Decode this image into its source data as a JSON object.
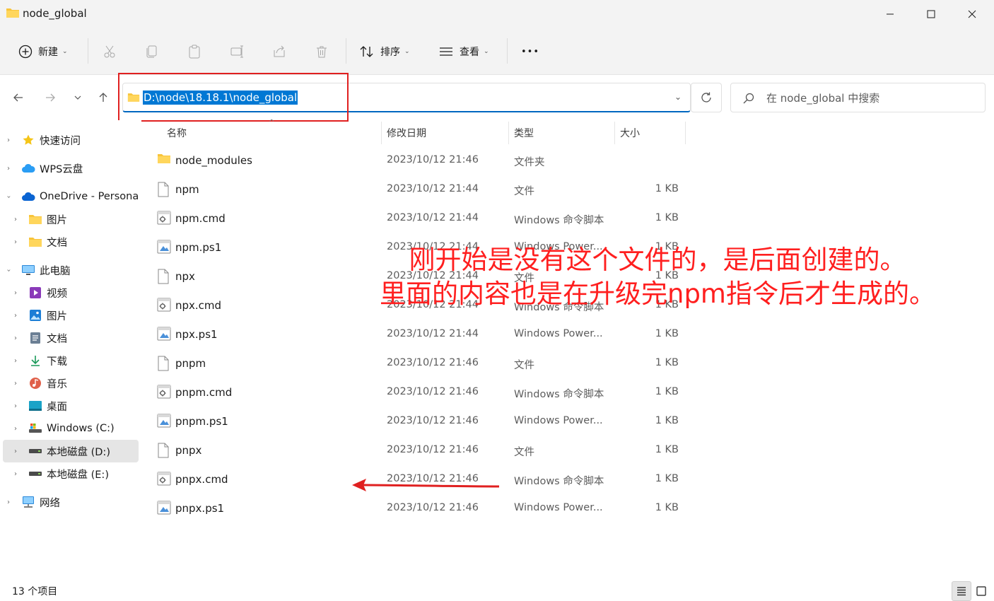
{
  "window": {
    "title": "node_global",
    "minimize_glyph": "—",
    "maximize_glyph": "☐",
    "close_glyph": "✕"
  },
  "toolbar": {
    "new_label": "新建",
    "sort_label": "排序",
    "view_label": "查看",
    "more_glyph": "•••"
  },
  "address": {
    "path": "D:\\node\\18.18.1\\node_global",
    "search_placeholder": "在 node_global 中搜索"
  },
  "sidebar": {
    "items": [
      {
        "label": "快速访问",
        "icon": "star-icon"
      },
      {
        "label": "WPS云盘",
        "icon": "cloud-icon"
      },
      {
        "label": "OneDrive - Persona",
        "icon": "onedrive-icon"
      },
      {
        "label": "图片",
        "icon": "folder-icon"
      },
      {
        "label": "文档",
        "icon": "folder-icon"
      },
      {
        "label": "此电脑",
        "icon": "computer-icon"
      },
      {
        "label": "视频",
        "icon": "video-icon"
      },
      {
        "label": "图片",
        "icon": "pictures-icon"
      },
      {
        "label": "文档",
        "icon": "documents-icon"
      },
      {
        "label": "下载",
        "icon": "download-icon"
      },
      {
        "label": "音乐",
        "icon": "music-icon"
      },
      {
        "label": "桌面",
        "icon": "desktop-icon"
      },
      {
        "label": "Windows (C:)",
        "icon": "drive-c-icon"
      },
      {
        "label": "本地磁盘 (D:)",
        "icon": "drive-icon"
      },
      {
        "label": "本地磁盘 (E:)",
        "icon": "drive-icon"
      },
      {
        "label": "网络",
        "icon": "network-icon"
      }
    ]
  },
  "columns": {
    "name": "名称",
    "date": "修改日期",
    "type": "类型",
    "size": "大小"
  },
  "files": [
    {
      "name": "node_modules",
      "date": "2023/10/12 21:46",
      "type": "文件夹",
      "size": "",
      "icon": "folder-icon"
    },
    {
      "name": "npm",
      "date": "2023/10/12 21:44",
      "type": "文件",
      "size": "1 KB",
      "icon": "file-icon"
    },
    {
      "name": "npm.cmd",
      "date": "2023/10/12 21:44",
      "type": "Windows 命令脚本",
      "size": "1 KB",
      "icon": "cmd-file-icon"
    },
    {
      "name": "npm.ps1",
      "date": "2023/10/12 21:44",
      "type": "Windows Power...",
      "size": "1 KB",
      "icon": "ps1-file-icon"
    },
    {
      "name": "npx",
      "date": "2023/10/12 21:44",
      "type": "文件",
      "size": "1 KB",
      "icon": "file-icon"
    },
    {
      "name": "npx.cmd",
      "date": "2023/10/12 21:44",
      "type": "Windows 命令脚本",
      "size": "1 KB",
      "icon": "cmd-file-icon"
    },
    {
      "name": "npx.ps1",
      "date": "2023/10/12 21:44",
      "type": "Windows Power...",
      "size": "1 KB",
      "icon": "ps1-file-icon"
    },
    {
      "name": "pnpm",
      "date": "2023/10/12 21:46",
      "type": "文件",
      "size": "1 KB",
      "icon": "file-icon"
    },
    {
      "name": "pnpm.cmd",
      "date": "2023/10/12 21:46",
      "type": "Windows 命令脚本",
      "size": "1 KB",
      "icon": "cmd-file-icon"
    },
    {
      "name": "pnpm.ps1",
      "date": "2023/10/12 21:46",
      "type": "Windows Power...",
      "size": "1 KB",
      "icon": "ps1-file-icon"
    },
    {
      "name": "pnpx",
      "date": "2023/10/12 21:46",
      "type": "文件",
      "size": "1 KB",
      "icon": "file-icon"
    },
    {
      "name": "pnpx.cmd",
      "date": "2023/10/12 21:46",
      "type": "Windows 命令脚本",
      "size": "1 KB",
      "icon": "cmd-file-icon"
    },
    {
      "name": "pnpx.ps1",
      "date": "2023/10/12 21:46",
      "type": "Windows Power...",
      "size": "1 KB",
      "icon": "ps1-file-icon"
    }
  ],
  "annotation": {
    "line1": "刚开始是没有这个文件的，是后面创建的。",
    "line2": "里面的内容也是在升级完npm指令后才生成的。",
    "color": "#ff1f1f"
  },
  "status": {
    "count": "13 个项目"
  },
  "colors": {
    "accent": "#0078d4",
    "highlight_box": "#e02020",
    "folder": "#f8c43a"
  }
}
